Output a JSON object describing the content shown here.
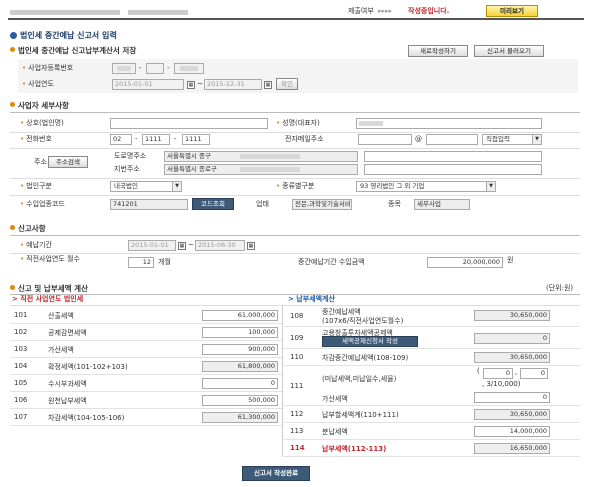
{
  "top": {
    "status_label": "제출여부",
    "arrows": "▸▸▸▸",
    "status_value": "작성중입니다.",
    "preview_btn": "미리보기"
  },
  "title": "법인세 중간예납 신고서 입력",
  "sec_doc": {
    "heading": "법인세 중간예납 신고납부계산서 저장",
    "rewrite_btn": "새로작성하기",
    "load_btn": "신고서 불러오기",
    "biz_no_label": "사업자등록번호",
    "year_label": "사업연도",
    "date_from": "2015-01-01",
    "date_to": "2015-12-31",
    "confirm_btn": "확인"
  },
  "sec_basic": {
    "heading": "사업자 세부사항",
    "company_label": "상호(법인명)",
    "ceo_label": "성명(대표자)",
    "phone_label": "전화번호",
    "phone": [
      "02",
      "1111",
      "1111"
    ],
    "email_label": "전자메일주소",
    "at": "@",
    "email_domain": "직접입력",
    "addr_label": "주소",
    "addr_btn": "주소검색",
    "road_label": "도로명주소",
    "road_value": "서울특별시 중구",
    "lot_label": "지번주소",
    "lot_value": "서울특별시 종로구",
    "corp_type_label": "법인구분",
    "corp_type": "내국법인",
    "kind_label": "종류별구분",
    "kind": "93 영리법인 그 외 기업",
    "code_label": "수입업종코드",
    "code": "741201",
    "code_btn": "코드조회",
    "biz_type_label": "업태",
    "biz_type": "전문,과학및기술서비",
    "item_label": "종목",
    "item": "세무사업"
  },
  "sec_report": {
    "heading": "신고사항",
    "period_label": "예납기간",
    "period_from": "2015-01-01",
    "period_to": "2015-06-30",
    "months_label": "직전사업연도 월수",
    "months": "12",
    "months_unit": "개월",
    "income_label": "중간예납기간 수입금액",
    "income": "20,000,000",
    "income_unit": "원"
  },
  "sec_calc": {
    "heading": "신고 및 납부세액 계산",
    "unit": "(단위:원)",
    "left_title": "> 직전 사업연도 법인세",
    "right_title": "> 납부세액계산",
    "left_rows": [
      {
        "no": "101",
        "label": "산출세액",
        "value": "61,000,000"
      },
      {
        "no": "102",
        "label": "공제감면세액",
        "value": "100,000"
      },
      {
        "no": "103",
        "label": "가산세액",
        "value": "900,000"
      },
      {
        "no": "104",
        "label": "확정세액(101-102+103)",
        "value": "61,800,000"
      },
      {
        "no": "105",
        "label": "수시부과세액",
        "value": "0"
      },
      {
        "no": "106",
        "label": "원천납부세액",
        "value": "500,000"
      },
      {
        "no": "107",
        "label": "차감세액(104-105-106)",
        "value": "61,300,000"
      }
    ],
    "r108": {
      "no": "108",
      "label": "중간예납세액",
      "sub": "(107x6/직전사업연도월수)",
      "value": "30,650,000"
    },
    "r109": {
      "no": "109",
      "label": "고용창출투자세액공제액",
      "btn": "세액공제신청서 작성",
      "value": "0"
    },
    "r110": {
      "no": "110",
      "label": "차감중간예납세액(108-109)",
      "value": "30,650,000"
    },
    "r111": {
      "no": "111",
      "label": "(미납세액,미납일수,세율)",
      "open": "(",
      "v1": "0",
      "v2": "0",
      "rate": ", 3/10,000)",
      "sub_label": "가산세액",
      "value": "0"
    },
    "r112": {
      "no": "112",
      "label": "납부할세액계(110+111)",
      "value": "30,650,000"
    },
    "r113": {
      "no": "113",
      "label": "분납세액",
      "value": "14,000,000"
    },
    "r114": {
      "no": "114",
      "label": "납부세액(112-113)",
      "value": "16,650,000"
    }
  },
  "submit_btn": "신고서 작성완료",
  "colors": {
    "accent": "#e08a00",
    "red": "#c0272d",
    "blue_link": "#1f5aa8",
    "dark_btn": "#3d5a78"
  }
}
